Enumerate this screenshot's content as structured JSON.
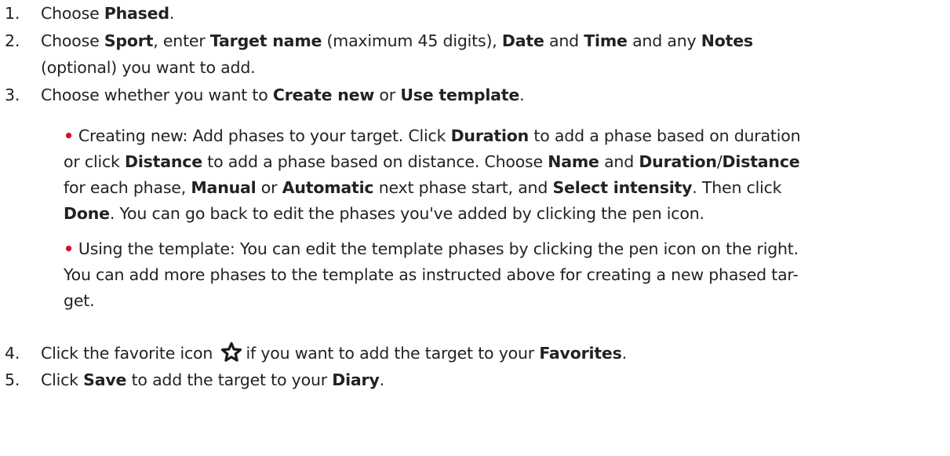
{
  "steps": [
    {
      "num": "1.",
      "lines": [
        [
          {
            "t": "Choose "
          },
          {
            "t": "Phased",
            "b": true
          },
          {
            "t": "."
          }
        ]
      ]
    },
    {
      "num": "2.",
      "lines": [
        [
          {
            "t": "Choose "
          },
          {
            "t": "Sport",
            "b": true
          },
          {
            "t": ", enter "
          },
          {
            "t": "Target name",
            "b": true
          },
          {
            "t": " (maximum 45 digits), "
          },
          {
            "t": "Date",
            "b": true
          },
          {
            "t": " and "
          },
          {
            "t": "Time",
            "b": true
          },
          {
            "t": " and any "
          },
          {
            "t": "Notes",
            "b": true
          }
        ],
        [
          {
            "t": "(optional) you want to add."
          }
        ]
      ]
    },
    {
      "num": "3.",
      "lines": [
        [
          {
            "t": "Choose whether you want to "
          },
          {
            "t": "Create new",
            "b": true
          },
          {
            "t": " or "
          },
          {
            "t": "Use template",
            "b": true
          },
          {
            "t": "."
          }
        ]
      ]
    },
    {
      "num": "4.",
      "lines": [
        [
          {
            "t": "Click the favorite icon "
          },
          {
            "icon": "star-icon"
          },
          {
            "t": "if you want to add the target to your "
          },
          {
            "t": "Favorites",
            "b": true
          },
          {
            "t": "."
          }
        ]
      ]
    },
    {
      "num": "5.",
      "lines": [
        [
          {
            "t": "Click "
          },
          {
            "t": "Save",
            "b": true
          },
          {
            "t": " to add the target to your "
          },
          {
            "t": "Diary",
            "b": true
          },
          {
            "t": "."
          }
        ]
      ]
    }
  ],
  "bullets": [
    {
      "lines": [
        [
          {
            "t": "Creating new: Add phases to your target. Click "
          },
          {
            "t": "Duration",
            "b": true
          },
          {
            "t": " to add a phase based on duration"
          }
        ],
        [
          {
            "t": "or click "
          },
          {
            "t": "Distance",
            "b": true
          },
          {
            "t": " to add a phase based on distance. Choose "
          },
          {
            "t": "Name",
            "b": true
          },
          {
            "t": " and "
          },
          {
            "t": "Duration",
            "b": true
          },
          {
            "t": "/"
          },
          {
            "t": "Distance",
            "b": true
          }
        ],
        [
          {
            "t": "for each phase, "
          },
          {
            "t": "Manual",
            "b": true
          },
          {
            "t": " or "
          },
          {
            "t": "Automatic",
            "b": true
          },
          {
            "t": " next phase start, and "
          },
          {
            "t": "Select intensity",
            "b": true
          },
          {
            "t": ". Then click"
          }
        ],
        [
          {
            "t": "Done",
            "b": true
          },
          {
            "t": ". You can go back to edit the phases you've added by clicking the pen icon."
          }
        ]
      ]
    },
    {
      "lines": [
        [
          {
            "t": "Using the template: You can edit the template phases by clicking the pen icon on the right."
          }
        ],
        [
          {
            "t": "You can add more phases to the template as instructed above for creating a new phased tar-"
          }
        ],
        [
          {
            "t": "get."
          }
        ]
      ]
    }
  ],
  "colors": {
    "text": "#222222",
    "bullet": "#d0102e",
    "icon": "#1a1a1a"
  }
}
